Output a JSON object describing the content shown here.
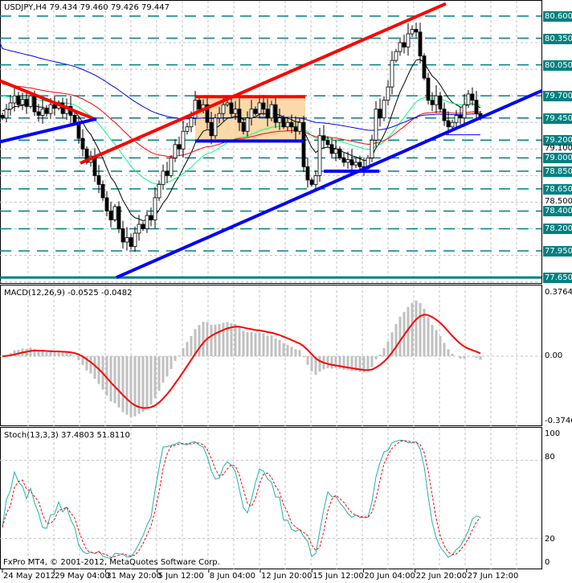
{
  "header": {
    "symbol_label": "USDJPY,H4  79.434 79.460 79.426 79.447"
  },
  "macd": {
    "label": "MACD(12,26,9) -0.0525 -0.0482",
    "fast": 12,
    "slow": 26,
    "signal": 9,
    "max_label": "0.3764",
    "zero_label": "0.00",
    "min_label": "-0.3746"
  },
  "stoch": {
    "label": "Stoch(13,3,3) 37.4803 51.8110",
    "k": 13,
    "slowing": 3,
    "d": 3,
    "levels": [
      "100",
      "80",
      "20",
      "0"
    ]
  },
  "footer": {
    "copyright": "FxPro MT4, © 2001-2012, MetaQuotes Software Corp."
  },
  "colors": {
    "bull": "#ffffff",
    "bear": "#000000",
    "level": "#008080",
    "trend_red": "#ff0000",
    "trend_blue": "#0000ff",
    "zone": "#fbd9a8",
    "ma_black": "#000000",
    "ma_green": "#00ff7f",
    "ma_red": "#ff0000",
    "ma_blue": "#0000ff",
    "stoch_k": "#20b2aa",
    "stoch_d": "#ff0000",
    "hist": "#c0c0c0"
  },
  "chart_data": {
    "type": "candlestick",
    "symbol": "USDJPY",
    "timeframe": "H4",
    "ylim": [
      77.6,
      80.65
    ],
    "closes": [
      79.45,
      79.55,
      79.62,
      79.7,
      79.6,
      79.66,
      79.58,
      79.7,
      79.52,
      79.48,
      79.55,
      79.5,
      79.6,
      79.56,
      79.62,
      79.5,
      79.58,
      79.48,
      79.4,
      79.22,
      79.1,
      78.95,
      79.02,
      78.8,
      78.7,
      78.55,
      78.4,
      78.3,
      78.45,
      78.2,
      78.05,
      78.1,
      78.0,
      78.15,
      78.25,
      78.2,
      78.35,
      78.3,
      78.55,
      78.7,
      78.85,
      78.8,
      79.0,
      79.15,
      79.1,
      79.3,
      79.35,
      79.45,
      79.65,
      79.55,
      79.6,
      79.4,
      79.25,
      79.45,
      79.5,
      79.6,
      79.62,
      79.5,
      79.55,
      79.4,
      79.3,
      79.45,
      79.55,
      79.5,
      79.62,
      79.55,
      79.45,
      79.6,
      79.4,
      79.45,
      79.35,
      79.4,
      79.35,
      79.3,
      79.4,
      78.9,
      78.75,
      78.7,
      78.8,
      79.25,
      79.2,
      79.15,
      79.05,
      79.1,
      79.0,
      78.95,
      78.98,
      78.92,
      78.95,
      78.9,
      78.88,
      79.0,
      79.2,
      79.55,
      79.45,
      79.65,
      79.8,
      80.1,
      80.2,
      80.3,
      80.25,
      80.4,
      80.45,
      80.42,
      80.15,
      79.9,
      79.65,
      79.6,
      79.7,
      79.55,
      79.42,
      79.35,
      79.4,
      79.48,
      79.45,
      79.6,
      79.72,
      79.65,
      79.5,
      79.447
    ],
    "moving_averages": [
      {
        "name": "black",
        "period": 10,
        "seed": 79.55
      },
      {
        "name": "green",
        "period": 30,
        "seed": 79.72
      },
      {
        "name": "red",
        "period": 55,
        "seed": 79.85
      },
      {
        "name": "blue",
        "period": 100,
        "seed": 80.25
      }
    ],
    "levels": [
      "80.600",
      "80.350",
      "80.050",
      "79.700",
      "79.450",
      "79.200",
      "79.000",
      "78.850",
      "78.650",
      "78.400",
      "78.200",
      "77.950",
      "77.650"
    ],
    "grid_labels": [
      "79.100",
      "78.500"
    ],
    "trendlines": [
      {
        "color": "red",
        "from": [
          -0.6,
          79.87
        ],
        "to": [
          23.4,
          79.43
        ]
      },
      {
        "color": "blue",
        "from": [
          -0.6,
          79.18
        ],
        "to": [
          23.4,
          79.44
        ]
      },
      {
        "color": "red",
        "from": [
          19.4,
          78.94
        ],
        "to": [
          110.4,
          80.74
        ]
      },
      {
        "color": "blue",
        "from": [
          28.4,
          77.65
        ],
        "to": [
          134.4,
          79.76
        ]
      },
      {
        "color": "red",
        "from": [
          48,
          79.69
        ],
        "to": [
          75.4,
          79.69
        ]
      },
      {
        "color": "blue",
        "from": [
          48,
          79.19
        ],
        "to": [
          75,
          79.19
        ]
      },
      {
        "color": "blue",
        "from": [
          80,
          78.85
        ],
        "to": [
          93.8,
          78.85
        ]
      }
    ],
    "zone": {
      "from_bar": 48,
      "to_bar": 75.4,
      "high": 79.69,
      "low": 79.19
    },
    "time_labels": [
      "24 May 2012",
      "29 May 04:00",
      "31 May 20:00",
      "5 Jun 12:00",
      "8 Jun 04:00",
      "12 Jun 20:00",
      "15 Jun 12:00",
      "20 Jun 04:00",
      "22 Jun 20:00",
      "27 Jun 12:00"
    ]
  }
}
